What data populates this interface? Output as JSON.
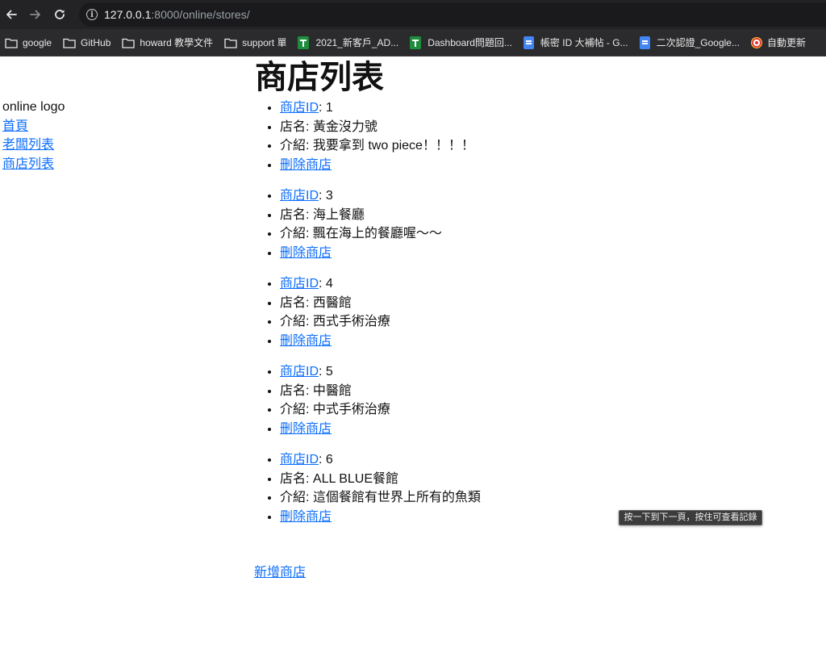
{
  "browser": {
    "url_host": "127.0.0.1",
    "url_path": ":8000/online/stores/",
    "bookmarks": [
      {
        "label": "google",
        "icon": "folder-icon"
      },
      {
        "label": "GitHub",
        "icon": "folder-icon"
      },
      {
        "label": "howard 教學文件",
        "icon": "folder-icon"
      },
      {
        "label": "support 單",
        "icon": "folder-icon"
      },
      {
        "label": "2021_新客戶_AD...",
        "icon": "sheets-icon"
      },
      {
        "label": "Dashboard問題回...",
        "icon": "sheets-icon"
      },
      {
        "label": "帳密 ID 大補帖 - G...",
        "icon": "docs-icon"
      },
      {
        "label": "二次認證_Google...",
        "icon": "docs-icon"
      },
      {
        "label": "自動更新",
        "icon": "target-icon"
      }
    ],
    "tooltip": "按一下到下一頁，按住可查看記錄"
  },
  "sidebar": {
    "logo_text": "online logo",
    "links": [
      "首頁",
      "老闆列表",
      "商店列表"
    ]
  },
  "main": {
    "title": "商店列表",
    "id_link_label": "商店ID",
    "name_prefix": "店名: ",
    "intro_prefix": "介紹: ",
    "delete_label": "刪除商店",
    "stores": [
      {
        "id": ": 1",
        "name": "黃金沒力號",
        "intro": "我要拿到 two piece！！！！"
      },
      {
        "id": ": 3",
        "name": "海上餐廳",
        "intro": "飄在海上的餐廳喔～～"
      },
      {
        "id": ": 4",
        "name": "西醫館",
        "intro": "西式手術治療"
      },
      {
        "id": ": 5",
        "name": "中醫館",
        "intro": "中式手術治療"
      },
      {
        "id": ": 6",
        "name": "ALL BLUE餐館",
        "intro": "這個餐館有世界上所有的魚類"
      }
    ],
    "add_link": "新增商店"
  },
  "colors": {
    "link": "#0d6efd",
    "toolbar": "#232325",
    "bookmarks_bar": "#2b2b2d"
  }
}
